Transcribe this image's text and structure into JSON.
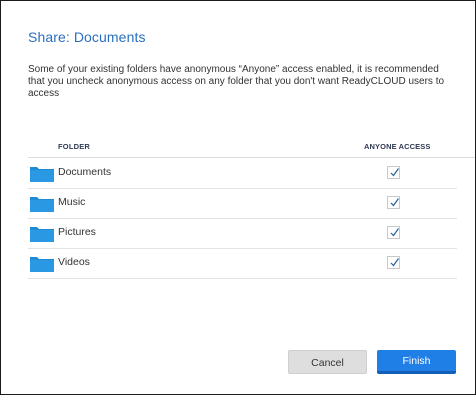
{
  "dialog": {
    "title": "Share: Documents",
    "message": "Some of your existing folders have anonymous “Anyone” access enabled, it is recommended that you uncheck anonymous access on any folder that you don't want ReadyCLOUD users to access"
  },
  "table": {
    "columns": {
      "folder": "FOLDER",
      "access": "ANYONE ACCESS"
    },
    "rows": [
      {
        "name": "Documents",
        "anyone_access": true
      },
      {
        "name": "Music",
        "anyone_access": true
      },
      {
        "name": "Pictures",
        "anyone_access": true
      },
      {
        "name": "Videos",
        "anyone_access": true
      }
    ]
  },
  "buttons": {
    "cancel": "Cancel",
    "finish": "Finish"
  },
  "colors": {
    "title": "#2a6fbf",
    "folder_icon": "#1f8ad6",
    "finish_button": "#1f7fe6",
    "check": "#1f5f9a"
  },
  "icons": {
    "folder": "folder-icon",
    "check": "check-icon"
  }
}
